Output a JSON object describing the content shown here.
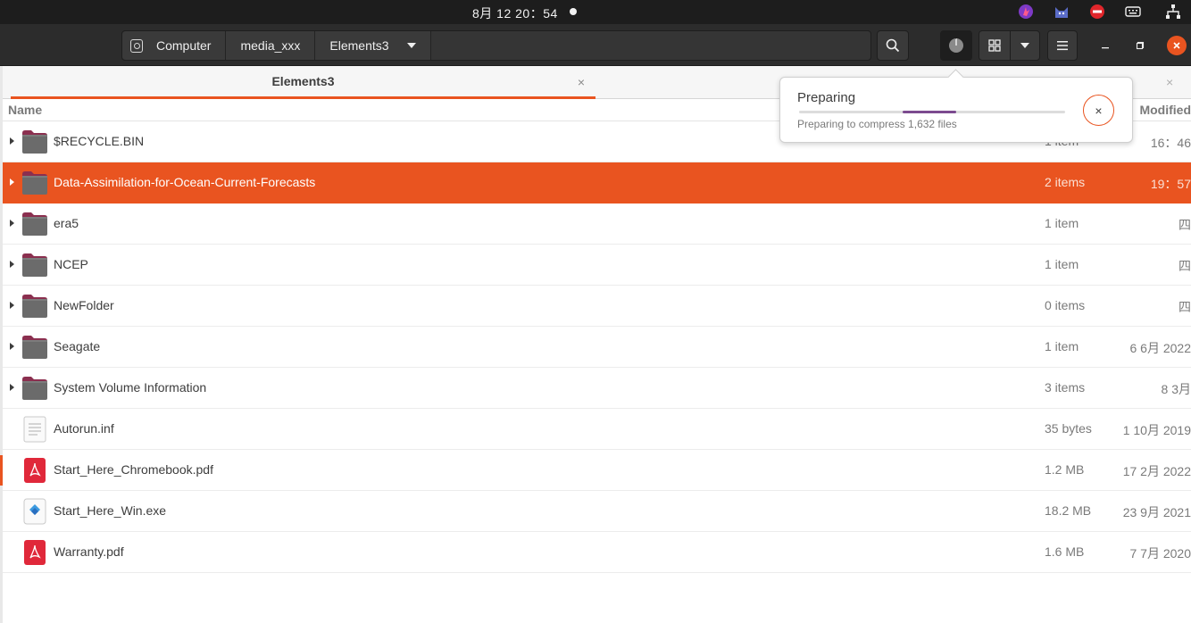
{
  "system_bar": {
    "clock": "8月 12  20：54",
    "tray_icons": [
      "app-indicator-icon",
      "cat-indicator-icon",
      "do-not-disturb-icon",
      "keyboard-icon",
      "network-icon"
    ]
  },
  "header": {
    "path": [
      "Computer",
      "media_xxx",
      "Elements3"
    ],
    "path_icons": [
      "drive-icon",
      "",
      "chevron-down-icon"
    ]
  },
  "tab": {
    "label": "Elements3",
    "close": "×"
  },
  "tab2_close": "×",
  "columns": {
    "name": "Name",
    "modified": "Modified"
  },
  "operation": {
    "title": "Preparing",
    "detail": "Preparing to compress 1,632 files",
    "progress_start": 0.39,
    "progress_end": 0.59,
    "cancel": "×",
    "accent": "#7c4b8f"
  },
  "colors": {
    "accent": "#e95420",
    "headerbar": "#2c2c2c",
    "folder": "#6b6b6b",
    "folder_tab": "#8b2f4f"
  },
  "files": [
    {
      "name": "$RECYCLE.BIN",
      "size": "1 item",
      "modified": "16：46",
      "type": "folder",
      "expandable": true,
      "selected": false
    },
    {
      "name": "Data-Assimilation-for-Ocean-Current-Forecasts",
      "size": "2 items",
      "modified": "19：57",
      "type": "folder",
      "expandable": true,
      "selected": true
    },
    {
      "name": "era5",
      "size": "1 item",
      "modified": "四",
      "type": "folder",
      "expandable": true,
      "selected": false
    },
    {
      "name": "NCEP",
      "size": "1 item",
      "modified": "四",
      "type": "folder",
      "expandable": true,
      "selected": false
    },
    {
      "name": "NewFolder",
      "size": "0 items",
      "modified": "四",
      "type": "folder",
      "expandable": true,
      "selected": false
    },
    {
      "name": "Seagate",
      "size": "1 item",
      "modified": "6 6月 2022",
      "type": "folder",
      "expandable": true,
      "selected": false
    },
    {
      "name": "System Volume Information",
      "size": "3 items",
      "modified": "8 3月",
      "type": "folder",
      "expandable": true,
      "selected": false
    },
    {
      "name": "Autorun.inf",
      "size": "35 bytes",
      "modified": "1 10月 2019",
      "type": "text",
      "expandable": false,
      "selected": false
    },
    {
      "name": "Start_Here_Chromebook.pdf",
      "size": "1.2 MB",
      "modified": "17 2月 2022",
      "type": "pdf",
      "expandable": false,
      "selected": false,
      "marked": true
    },
    {
      "name": "Start_Here_Win.exe",
      "size": "18.2 MB",
      "modified": "23 9月 2021",
      "type": "exe",
      "expandable": false,
      "selected": false
    },
    {
      "name": "Warranty.pdf",
      "size": "1.6 MB",
      "modified": "7 7月 2020",
      "type": "pdf",
      "expandable": false,
      "selected": false
    }
  ]
}
